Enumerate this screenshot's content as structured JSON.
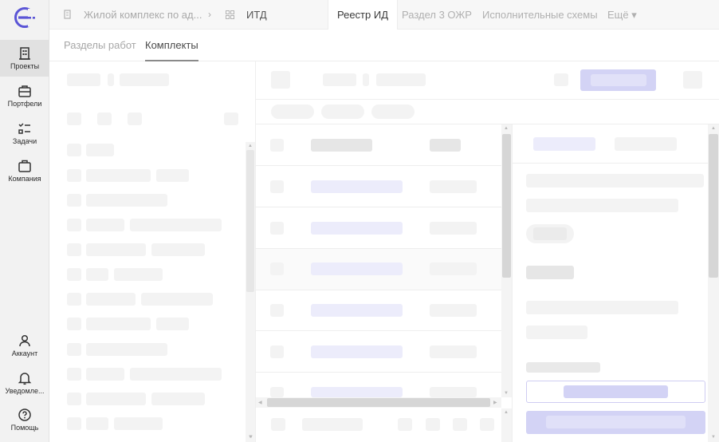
{
  "rail": {
    "items": [
      {
        "label": "Проекты",
        "icon": "building-icon"
      },
      {
        "label": "Портфели",
        "icon": "briefcase-list-icon"
      },
      {
        "label": "Задачи",
        "icon": "checklist-icon"
      },
      {
        "label": "Компания",
        "icon": "briefcase-icon"
      }
    ],
    "bottom_items": [
      {
        "label": "Аккаунт",
        "icon": "user-icon"
      },
      {
        "label": "Уведомле...",
        "icon": "bell-icon"
      },
      {
        "label": "Помощь",
        "icon": "help-icon"
      }
    ]
  },
  "breadcrumb": {
    "project": "Жилой комплекс по ад...",
    "separator": "›",
    "section": "ИТД"
  },
  "tabs": [
    {
      "label": "Реестр ИД"
    },
    {
      "label": "Раздел 3 ОЖР"
    },
    {
      "label": "Исполнительные схемы"
    },
    {
      "label": "Ещё ▾"
    }
  ],
  "subtabs": [
    {
      "label": "Разделы работ"
    },
    {
      "label": "Комплекты"
    }
  ],
  "colors": {
    "accent": "#5b55d6",
    "accent_skeleton": "#d3d3f5"
  }
}
